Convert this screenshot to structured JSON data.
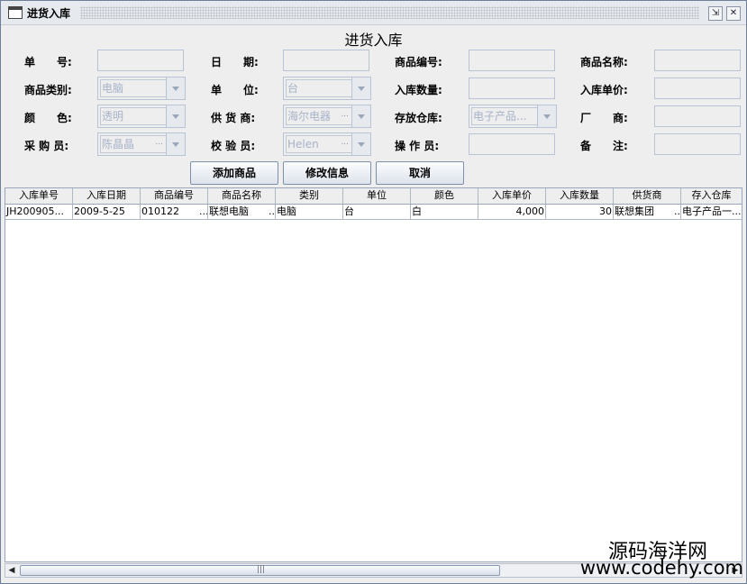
{
  "window": {
    "title": "进货入库"
  },
  "form": {
    "heading": "进货入库",
    "labels": {
      "order_no": "单　　号:",
      "date": "日　　期:",
      "product_code": "商品编号:",
      "product_name": "商品名称:",
      "category": "商品类别:",
      "unit": "单　　位:",
      "quantity": "入库数量:",
      "unit_price": "入库单价:",
      "color": "颜　　色:",
      "supplier": "供 货 商:",
      "warehouse": "存放仓库:",
      "manufacturer": "厂　　商:",
      "buyer": "采 购 员:",
      "inspector": "校 验 员:",
      "operator": "操 作 员:",
      "remark": "备　　注:"
    },
    "values": {
      "category": "电脑",
      "unit": "台",
      "color": "透明",
      "supplier": "海尔电器",
      "warehouse": "电子产品...",
      "buyer": "陈晶晶",
      "inspector": "Helen",
      "ellipsis": "..."
    }
  },
  "buttons": {
    "add": "添加商品",
    "modify": "修改信息",
    "cancel": "取消"
  },
  "table": {
    "columns": [
      "入库单号",
      "入库日期",
      "商品编号",
      "商品名称",
      "类别",
      "单位",
      "颜色",
      "入库单价",
      "入库数量",
      "供货商",
      "存入仓库"
    ],
    "rows": [
      [
        "JH200905...",
        "2009-5-25",
        "010122　　...",
        "联想电脑　　...",
        "电脑",
        "台",
        "白",
        "4,000",
        "30",
        "联想集团　　...",
        "电子产品一..."
      ]
    ]
  },
  "watermark": {
    "line1": "源码海洋网",
    "line2": "www.codehy.com"
  }
}
